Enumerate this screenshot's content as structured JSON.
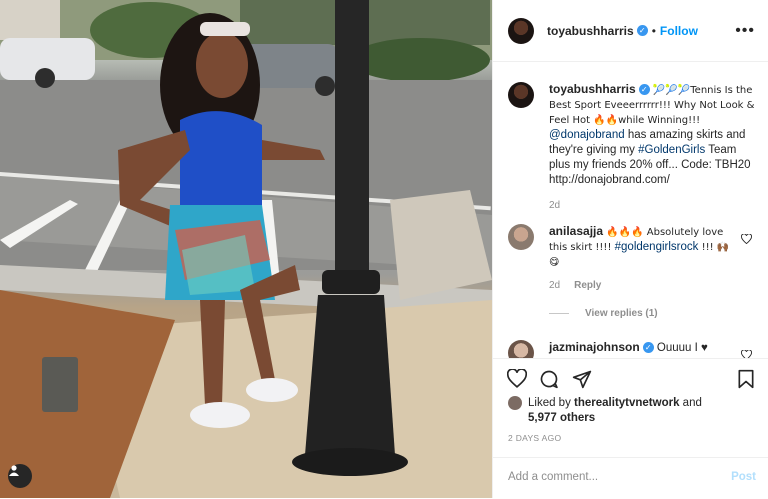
{
  "post": {
    "username": "toyabushharris",
    "follow_label": "Follow",
    "more_label": "•••"
  },
  "caption": {
    "username": "toyabushharris",
    "text_1": "🎾🎾🎾Tennis Is the Best Sport Eveeerrrrrr!!! Why Not Look & Feel Hot 🔥🔥while Winning!!!",
    "mention": "@donajobrand",
    "text_2": " has amazing skirts and they're giving my ",
    "hashtag": "#GoldenGirls",
    "text_3": " Team plus my friends 20% off... Code: TBH20 http://donajobrand.com/",
    "time": "2d"
  },
  "comments": [
    {
      "username": "anilasajja",
      "text_1": "🔥🔥🔥 Absolutely love this skirt !!!! ",
      "hashtag": "#goldengirlsrock",
      "text_2": " !!! 🙌🏾😋",
      "time": "2d",
      "reply_label": "Reply",
      "view_replies": "View replies (1)"
    },
    {
      "username": "jazminajohnson",
      "text_1": "Ouuuu I ♥"
    }
  ],
  "actions": {
    "liked_by_prefix": "Liked by ",
    "liked_by_user": "therealitytvnetwork",
    "liked_by_suffix": " and",
    "others": "5,977 others",
    "date": "2 DAYS AGO"
  },
  "add_comment": {
    "placeholder": "Add a comment...",
    "post_label": "Post"
  },
  "colors": {
    "accent": "#0095f6",
    "verified": "#3897f0",
    "muted": "#8e8e8e",
    "post_disabled": "#b2dffc"
  }
}
